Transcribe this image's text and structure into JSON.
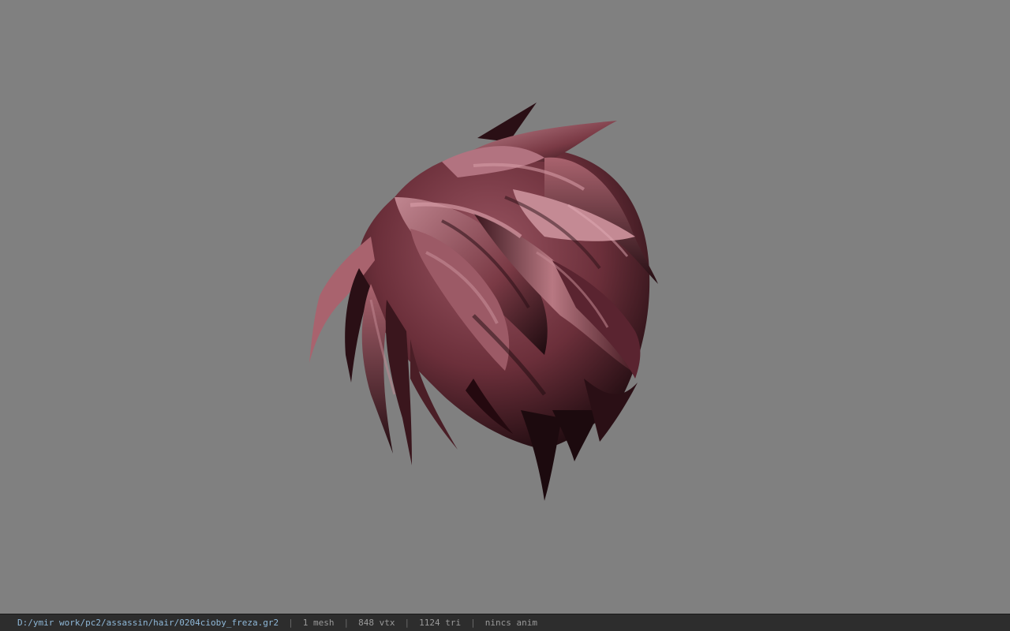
{
  "viewport": {
    "model": "hair-mesh",
    "background_color": "#808080",
    "hair_light_color": "#b87882",
    "hair_mid_color": "#7a3a45",
    "hair_dark_color": "#1c0a0e"
  },
  "statusbar": {
    "file_path": "D:/ymir work/pc2/assassin/hair/0204cioby_freza.gr2",
    "separator": "|",
    "mesh_count": "1 mesh",
    "vertex_count": "848 vtx",
    "triangle_count": "1124 tri",
    "animation": "nincs anim"
  }
}
